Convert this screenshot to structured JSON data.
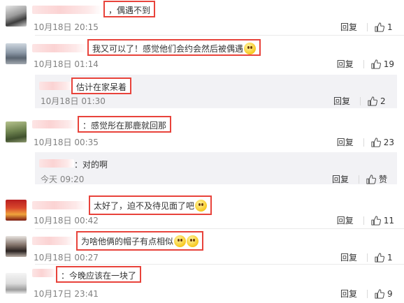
{
  "comments": [
    {
      "text": "，偶遇不到",
      "time": "10月18日 20:15",
      "reply": "回复",
      "likes": "1"
    },
    {
      "text": "我又可以了！感觉他们会约会然后被偶遇",
      "time": "10月18日 01:14",
      "reply": "回复",
      "likes": "19"
    },
    {
      "text": "估计在家呆着",
      "time": "10月18日 01:30",
      "reply": "回复",
      "likes": "2"
    },
    {
      "text": "：感觉彤在那鹿就回那",
      "time": "10月18日 00:35",
      "reply": "回复",
      "likes": "23"
    },
    {
      "text": "：对的啊",
      "time": "今天 09:20",
      "reply": "回复",
      "likes": "赞"
    },
    {
      "text": "太好了，迫不及待见面了吧",
      "time": "10月18日 00:42",
      "reply": "回复",
      "likes": "11"
    },
    {
      "text": "为啥他俩的帽子有点相似",
      "time": "10月18日 00:27",
      "reply": "回复",
      "likes": "1"
    },
    {
      "text": "：今晚应该在一块了",
      "time": "10月17日 23:41",
      "reply": "回复",
      "likes": "9"
    }
  ]
}
